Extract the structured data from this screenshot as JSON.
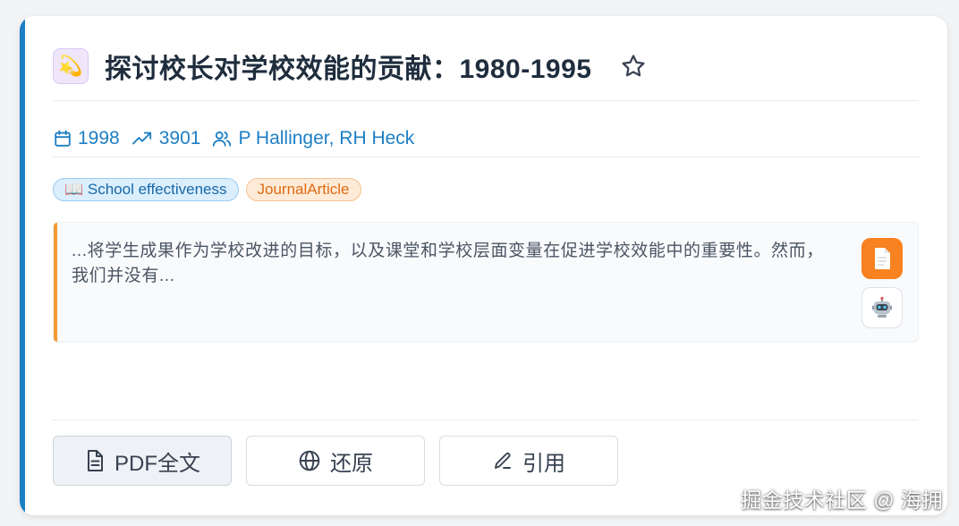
{
  "paper": {
    "emoji": "💫",
    "title": "探讨校长对学校效能的贡献：1980-1995",
    "year": "1998",
    "citations": "3901",
    "authors": [
      {
        "name": "P Hallinger"
      },
      {
        "name": "RH Heck"
      }
    ],
    "author_separator": ", ",
    "tags": [
      {
        "label": "📖 School effectiveness",
        "color": "#1769aa"
      },
      {
        "label": "JournalArticle",
        "color": "#e06a12"
      }
    ],
    "abstract": "...将学生成果作为学校改进的目标，以及课堂和学校层面变量在促进学校效能中的重要性。然而，我们并没有..."
  },
  "icons": {
    "favorite": "star-outline-icon",
    "year": "calendar-icon",
    "citations": "trending-up-icon",
    "authors": "users-icon",
    "pdf_side": "document-icon",
    "ai_side": "robot-icon"
  },
  "side_buttons": {
    "pdf_glyph": "📄",
    "ai_glyph": "🤖"
  },
  "actions": {
    "pdf_label": "PDF全文",
    "restore_label": "还原",
    "cite_label": "引用"
  },
  "colors": {
    "accent": "#1d7fc4",
    "abstract_accent": "#f39a35",
    "pdf_button": "#f7821f"
  },
  "watermark": "掘金技术社区 @ 海拥"
}
